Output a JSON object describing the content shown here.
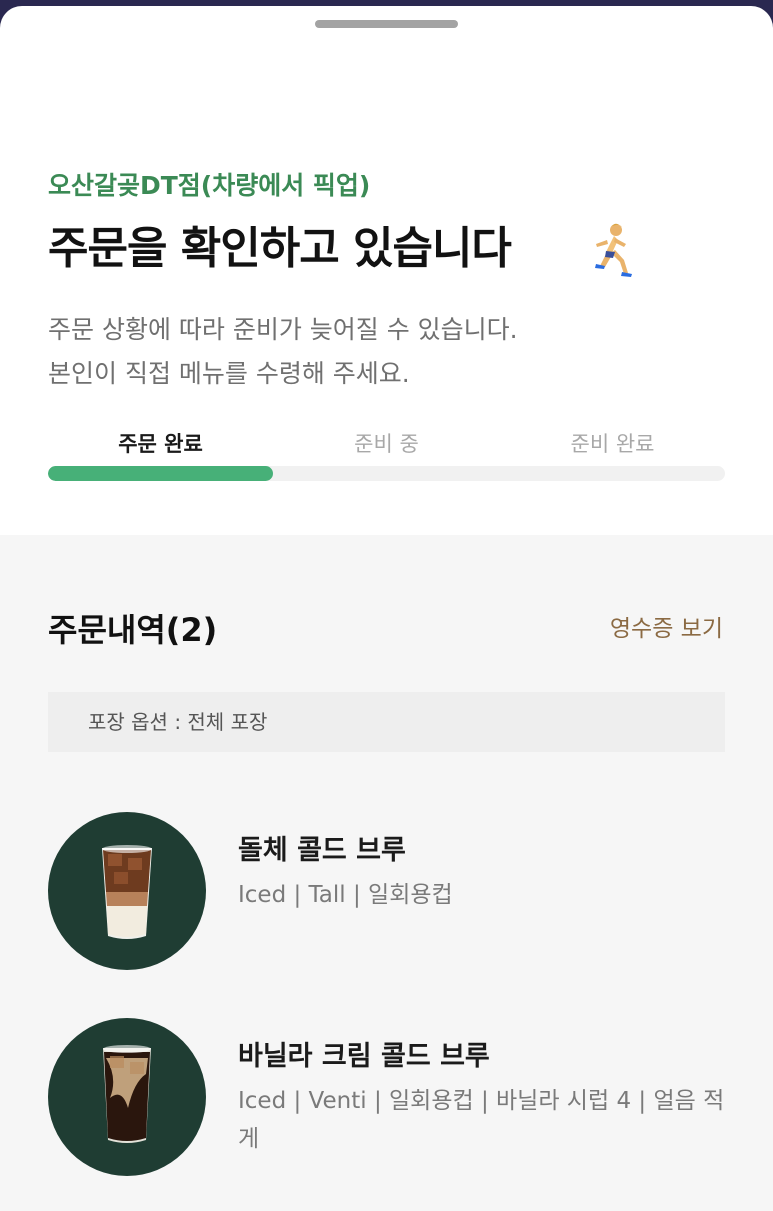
{
  "order": {
    "store_name": "오산갈곶DT점(차량에서 픽업)",
    "headline": "주문을 확인하고 있습니다",
    "description_line1": "주문 상황에 따라 준비가 늦어질 수 있습니다.",
    "description_line2": "본인이 직접 메뉴를 수령해 주세요.",
    "steps": [
      {
        "label": "주문 완료",
        "active": true
      },
      {
        "label": "준비 중",
        "active": false
      },
      {
        "label": "준비 완료",
        "active": false
      }
    ],
    "progress_fraction": 0.333
  },
  "history": {
    "title": "주문내역(2)",
    "receipt_label": "영수증 보기",
    "packaging_option": "포장 옵션 : 전체 포장",
    "items": [
      {
        "name": "돌체 콜드 브루",
        "options": "Iced | Tall | 일회용컵"
      },
      {
        "name": "바닐라 크림 콜드 브루",
        "options": "Iced | Venti | 일회용컵 | 바닐라 시럽 4 | 얼음 적게"
      }
    ]
  },
  "colors": {
    "brand_green": "#3b8a55",
    "progress_green": "#47b078",
    "receipt_brown": "#8b6a43",
    "thumb_bg": "#1f3d33"
  },
  "icons": {
    "headline_emoji": "woman-running-icon",
    "drag_handle": "drag-handle"
  }
}
